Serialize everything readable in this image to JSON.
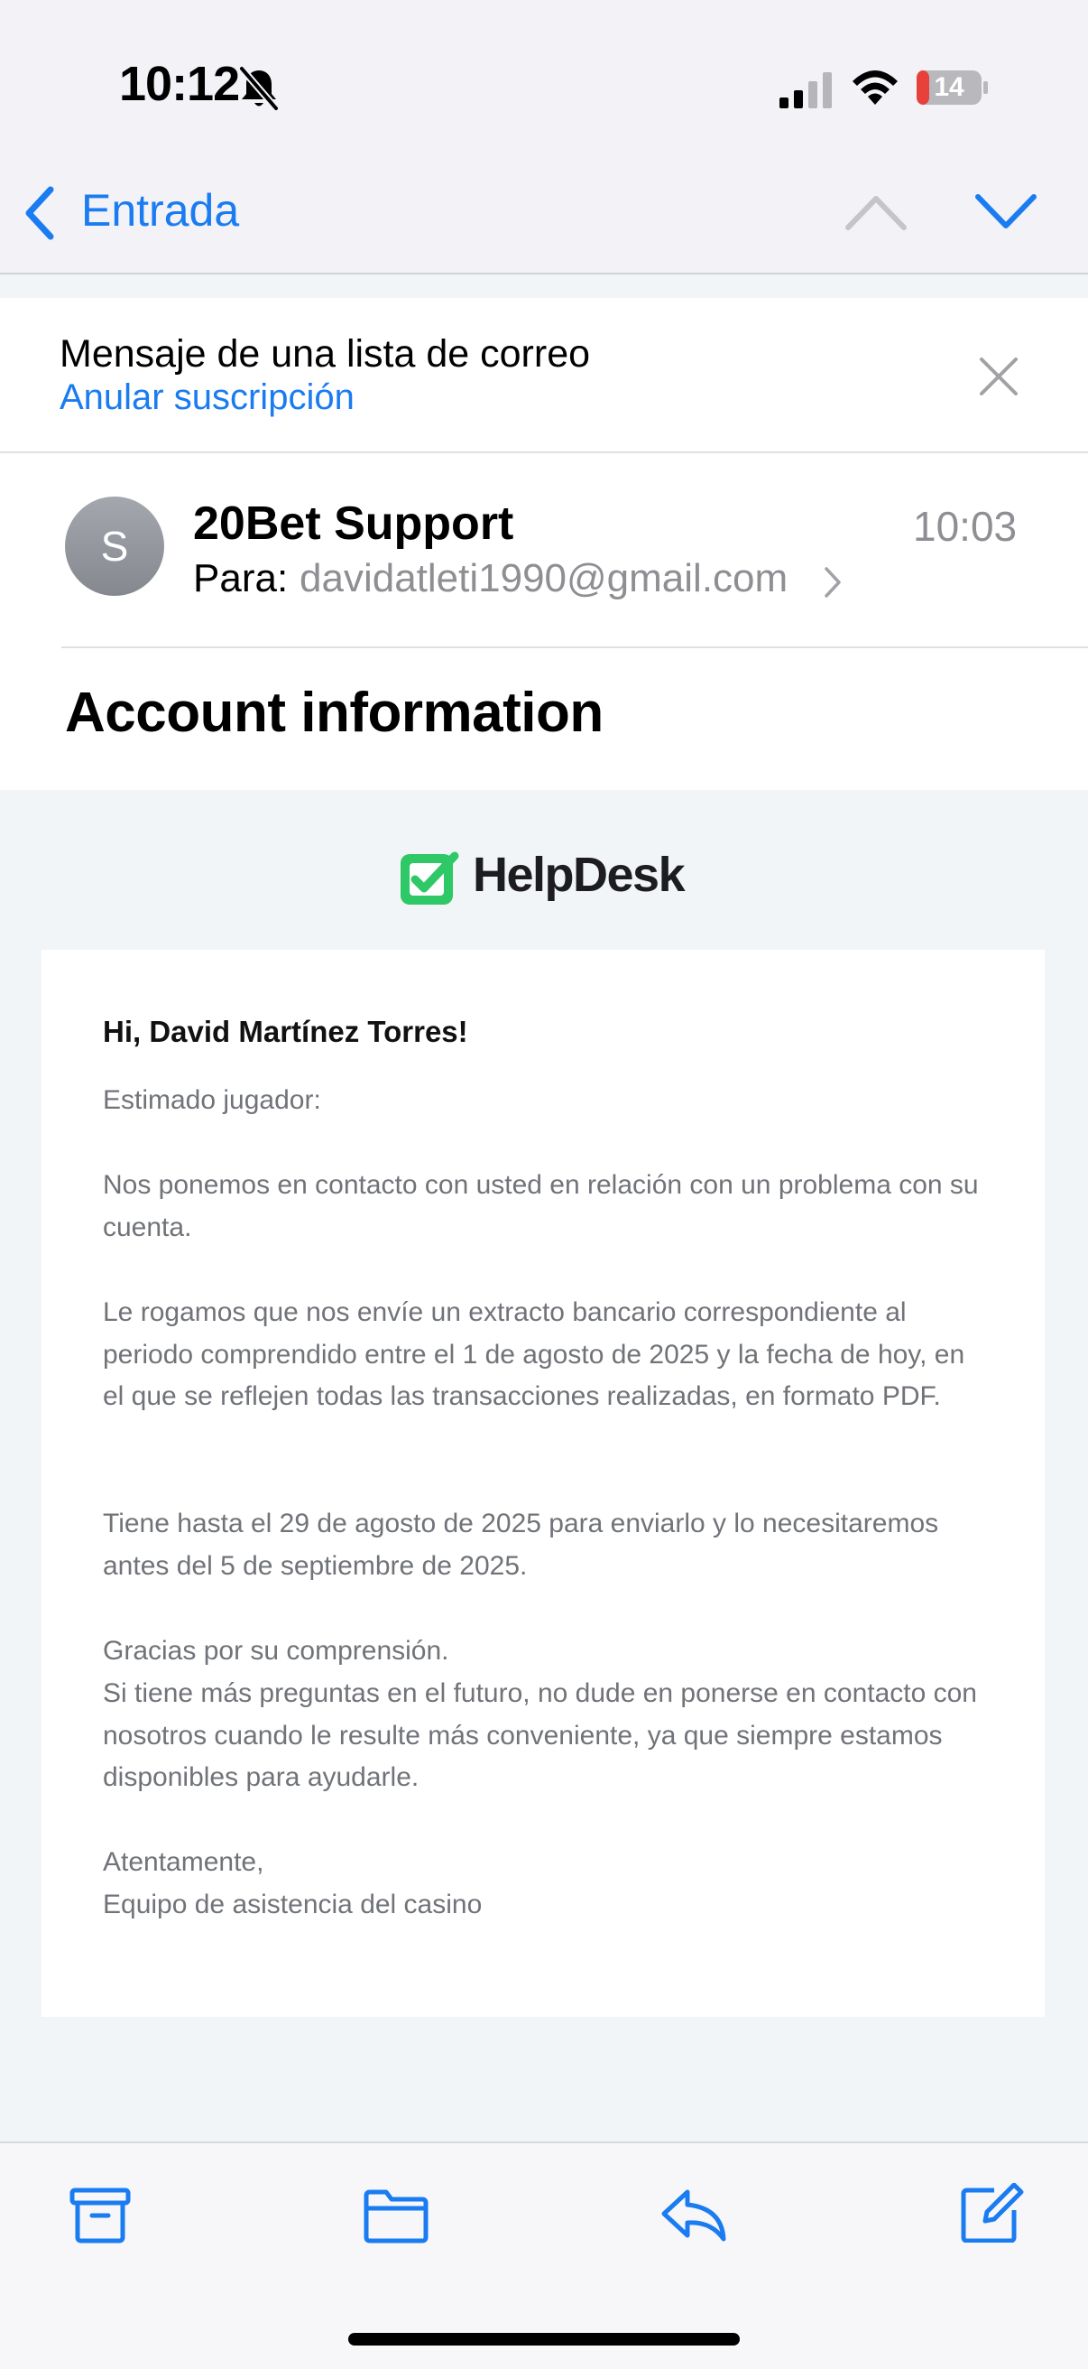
{
  "status_bar": {
    "time": "10:12",
    "battery_level": "14",
    "icons": [
      "bell-slash-icon",
      "signal-icon",
      "wifi-icon",
      "battery-icon"
    ]
  },
  "nav": {
    "back_label": "Entrada",
    "icons": [
      "chevron-left-icon",
      "chevron-up-icon",
      "chevron-down-icon"
    ]
  },
  "mailing_banner": {
    "title": "Mensaje de una lista de correo",
    "unsubscribe": "Anular suscripción",
    "icon": "close-icon"
  },
  "message": {
    "avatar_initial": "S",
    "sender": "20Bet Support",
    "to_label": "Para:",
    "to_address": "davidatleti1990@gmail.com",
    "time": "10:03",
    "subject": "Account information"
  },
  "email_body": {
    "logo_text": "HelpDesk",
    "greeting": "Hi, David Martínez Torres!",
    "p1": "Estimado jugador:",
    "p2": "Nos ponemos en contacto con usted en relación con un problema con su cuenta.",
    "p3": "Le rogamos que nos envíe un extracto bancario correspondiente al periodo comprendido entre el 1 de agosto de 2025 y la fecha de hoy, en el que se reflejen todas las transacciones realizadas, en formato PDF.",
    "p4": "Tiene hasta el 29 de agosto de 2025 para enviarlo y lo necesitaremos antes del 5 de septiembre de 2025.",
    "p5_line1": "Gracias por su comprensión.",
    "p5_line2": "Si tiene más preguntas en el futuro, no dude en ponerse en contacto con nosotros cuando le resulte más conveniente, ya que siempre estamos disponibles para ayudarle.",
    "closing": "Atentamente,",
    "signature": "Equipo de asistencia del casino"
  },
  "toolbar": {
    "icons": [
      "archive-icon",
      "folder-icon",
      "reply-icon",
      "compose-icon"
    ]
  },
  "colors": {
    "accent": "#1a7cf0",
    "logo_green": "#2ec866",
    "secondary_text": "#8e8e93",
    "body_text": "#707378",
    "battery_low": "#e8403a"
  }
}
